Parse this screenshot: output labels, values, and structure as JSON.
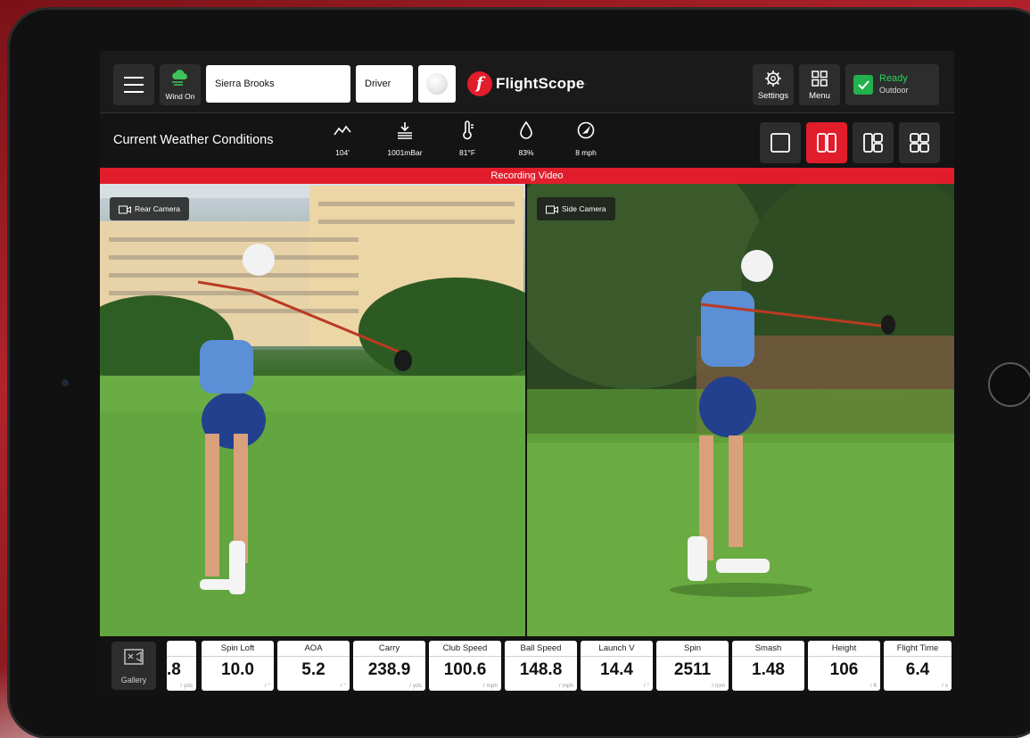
{
  "topbar": {
    "wind_label": "Wind On",
    "player_name": "Sierra Brooks",
    "club": "Driver",
    "brand_name": "FlightScope",
    "brand_mark": "·",
    "settings_label": "Settings",
    "menu_label": "Menu",
    "status_title": "Ready",
    "status_mode": "Outdoor"
  },
  "weather": {
    "title": "Current Weather Conditions",
    "altitude": "104'",
    "pressure": "1001mBar",
    "temperature": "81°F",
    "humidity": "83%",
    "wind_speed": "8 mph"
  },
  "recording_label": "Recording Video",
  "cameras": {
    "rear_label": "Rear Camera",
    "side_label": "Side Camera"
  },
  "gallery_label": "Gallery",
  "stats": [
    {
      "label": "",
      "value": ".8",
      "unit": "/ yds"
    },
    {
      "label": "Spin Loft",
      "value": "10.0",
      "unit": "/ °"
    },
    {
      "label": "AOA",
      "value": "5.2",
      "unit": "/ °"
    },
    {
      "label": "Carry",
      "value": "238.9",
      "unit": "/ yds"
    },
    {
      "label": "Club Speed",
      "value": "100.6",
      "unit": "/ mph"
    },
    {
      "label": "Ball Speed",
      "value": "148.8",
      "unit": "/ mph"
    },
    {
      "label": "Launch V",
      "value": "14.4",
      "unit": "/ °"
    },
    {
      "label": "Spin",
      "value": "2511",
      "unit": "/ rpm"
    },
    {
      "label": "Smash",
      "value": "1.48",
      "unit": ""
    },
    {
      "label": "Height",
      "value": "106",
      "unit": "/ ft"
    },
    {
      "label": "Flight Time",
      "value": "6.4",
      "unit": "/ s"
    }
  ],
  "colors": {
    "accent_red": "#e11d2b",
    "ready_green": "#22b14c",
    "panel": "#2d2d2d"
  },
  "icons": [
    "menu-icon",
    "wind-cloud-icon",
    "golf-ball-icon",
    "flightscope-logo",
    "settings-gear-icon",
    "grid-menu-icon",
    "check-icon",
    "altitude-icon",
    "pressure-icon",
    "thermometer-icon",
    "humidity-drop-icon",
    "wind-compass-icon",
    "layout-single-icon",
    "layout-dual-icon",
    "layout-triple-icon",
    "layout-quad-icon",
    "camera-icon",
    "gallery-icon"
  ]
}
